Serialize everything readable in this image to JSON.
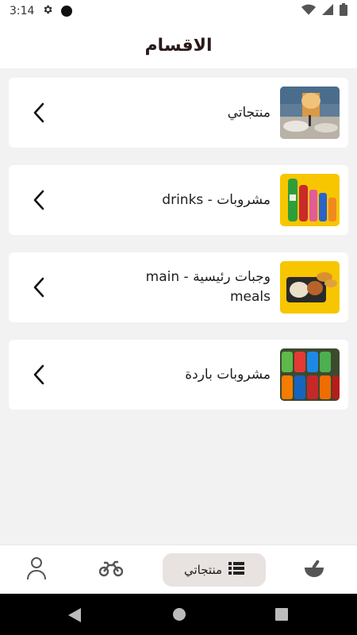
{
  "status_bar": {
    "time": "3:14"
  },
  "header": {
    "title": "الاقسام"
  },
  "categories": [
    {
      "label": "منتجاتي"
    },
    {
      "label": "مشروبات - drinks"
    },
    {
      "label": "وجبات رئيسية - main meals"
    },
    {
      "label": "مشروبات باردة"
    }
  ],
  "bottom_nav": {
    "active_label": "منتجاتي"
  },
  "colors": {
    "accent_pill": "#e8e2e1",
    "drinks_bg": "#f7c600",
    "card_bg": "#ffffff",
    "page_bg": "#f2f2f2"
  }
}
